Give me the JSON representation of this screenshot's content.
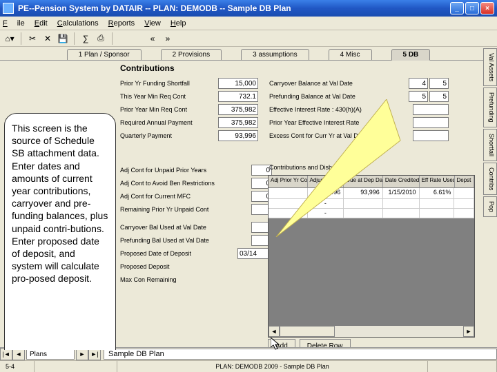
{
  "titlebar": {
    "title": "PE--Pension System by DATAIR -- PLAN: DEMODB -- Sample DB Plan"
  },
  "menubar": {
    "file": "File",
    "edit": "Edit",
    "calc": "Calculations",
    "reports": "Reports",
    "view": "View",
    "help": "Help"
  },
  "tabs": {
    "t1": "1 Plan / Sponsor",
    "t2": "2 Provisions",
    "t3": "3 assumptions",
    "t4": "4 Misc",
    "t5": "5 DB"
  },
  "panel": {
    "title": "Contributions"
  },
  "left": {
    "r1": {
      "label": "Prior Yr Funding Shortfall",
      "val": "15,000"
    },
    "r2": {
      "label": "This Year Min Req Cont",
      "val": "732.1"
    },
    "r3": {
      "label": "Prior Year Min Req Cont",
      "val": "375,982"
    },
    "r4": {
      "label": "Required Annual Payment",
      "val": "375,982"
    },
    "r5": {
      "label": "Quarterly Payment",
      "val": "93,996"
    }
  },
  "right": {
    "r1": {
      "label": "Carryover Balance at Val Date",
      "val1": "4",
      "val2": "5"
    },
    "r2": {
      "label": "Prefunding Balance at Val Date",
      "val1": "5",
      "val2": "5"
    },
    "r3": {
      "label": "Effective Interest Rate : 430(h)(A)",
      "val": ""
    },
    "r4": {
      "label": "Prior Year Effective Interest Rate",
      "val": ""
    },
    "r5": {
      "label": "Excess Cont for Curr Yr at Val Date",
      "val": ""
    }
  },
  "left2": {
    "r1": {
      "label": "Adj Cont for Unpaid Prior Years",
      "val": "0"
    },
    "r2": {
      "label": "Adj Cont to Avoid Ben Restrictions",
      "val": "0"
    },
    "r3": {
      "label": "Adj Cont for Current MFC",
      "val": "0"
    },
    "r4": {
      "label": "Remaining Prior Yr Unpaid Cont",
      "val": ""
    },
    "r5": {
      "label": "Carryover Bal Used at Val Date",
      "val": ""
    },
    "r6": {
      "label": "Prefunding Bal Used at Val Date",
      "val": ""
    },
    "r7": {
      "label": "Proposed Date of Deposit",
      "val": "03/14"
    },
    "r8": {
      "label": "Proposed Deposit",
      "val": ""
    },
    "r9": {
      "label": "Max Con Remaining",
      "val": ""
    }
  },
  "group": {
    "label": "Contributions and Disbursements"
  },
  "grid": {
    "h1": "Adj Prior Yr Cont",
    "h2": "Adjusted Qtrly",
    "h3": "Due at Dep Date",
    "h4": "Date Credited",
    "h5": "Eff Rate Used",
    "h6": "Depst",
    "r1c2": "93,996",
    "r1c3": "93,996",
    "r1c4": "1/15/2010",
    "r1c5": "6.61%"
  },
  "gridbtns": {
    "add": "Add",
    "del": "Delete Row"
  },
  "sidetabs": {
    "t1": "Val Assets",
    "t2": "Prefunding",
    "t3": "Shortfall",
    "t4": "Contribs",
    "t5": "Pop"
  },
  "callout": {
    "text": "This screen is the source of Schedule SB attachment data. Enter dates and amounts of current year contributions, carryover and pre-funding balances, plus unpaid contri-butions. Enter proposed date of deposit, and system will calculate pro-posed deposit."
  },
  "nav": {
    "field": "Plans",
    "plan": "Sample DB Plan"
  },
  "status": {
    "left": "5-4",
    "center": "PLAN: DEMODB  2009 - Sample DB Plan"
  }
}
